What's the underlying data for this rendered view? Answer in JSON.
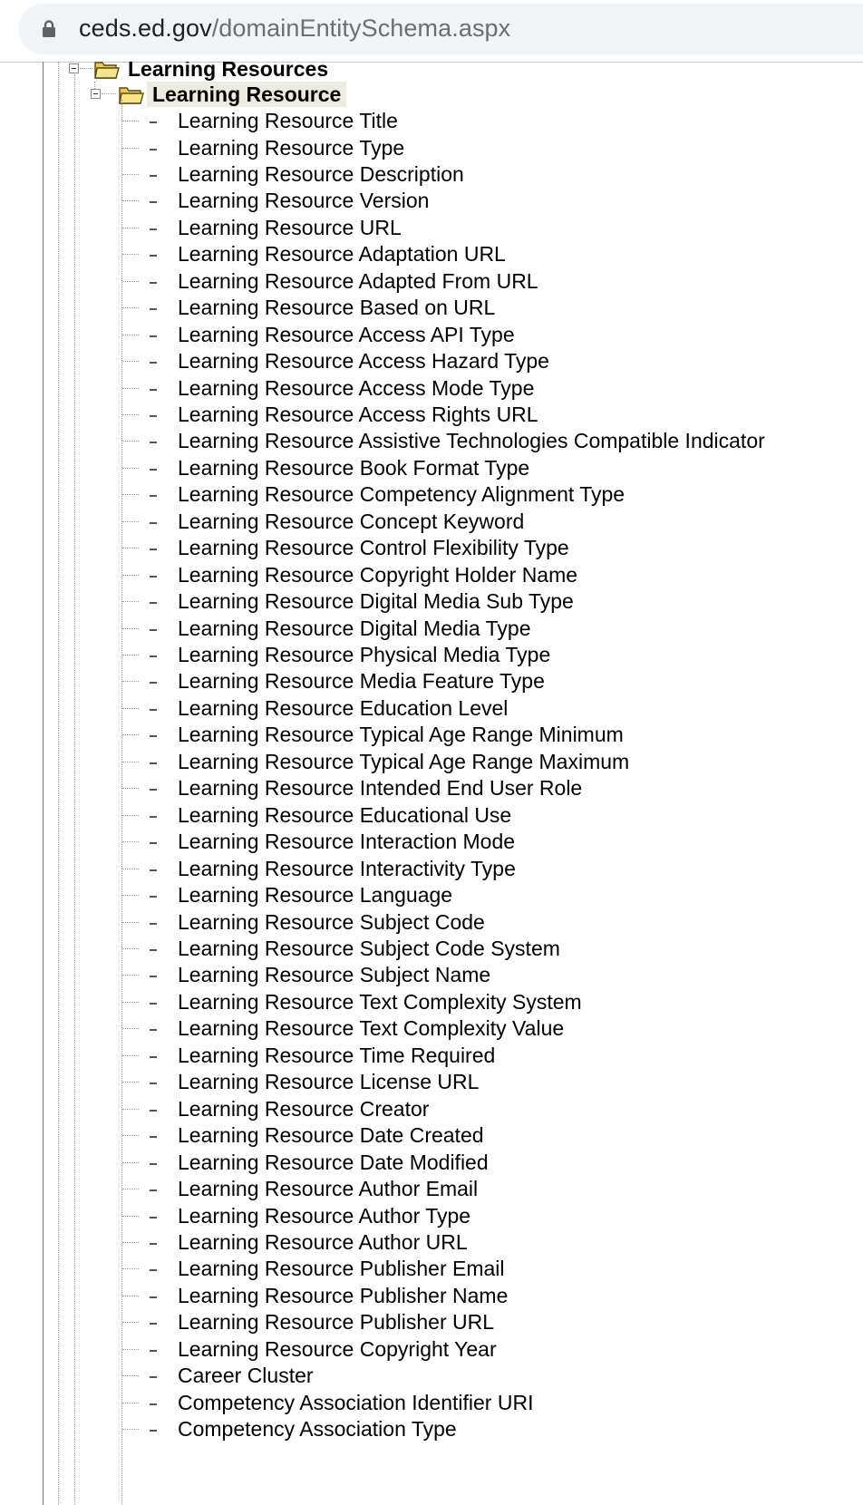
{
  "browser": {
    "url_host": "ceds.ed.gov",
    "url_path": "/domainEntitySchema.aspx"
  },
  "tree": {
    "parent": {
      "label": "Learning Resources"
    },
    "child": {
      "label": "Learning Resource"
    },
    "items": [
      "Learning Resource Title",
      "Learning Resource Type",
      "Learning Resource Description",
      "Learning Resource Version",
      "Learning Resource URL",
      "Learning Resource Adaptation URL",
      "Learning Resource Adapted From URL",
      "Learning Resource Based on URL",
      "Learning Resource Access API Type",
      "Learning Resource Access Hazard Type",
      "Learning Resource Access Mode Type",
      "Learning Resource Access Rights URL",
      "Learning Resource Assistive Technologies Compatible Indicator",
      "Learning Resource Book Format Type",
      "Learning Resource Competency Alignment Type",
      "Learning Resource Concept Keyword",
      "Learning Resource Control Flexibility Type",
      "Learning Resource Copyright Holder Name",
      "Learning Resource Digital Media Sub Type",
      "Learning Resource Digital Media Type",
      "Learning Resource Physical Media Type",
      "Learning Resource Media Feature Type",
      "Learning Resource Education Level",
      "Learning Resource Typical Age Range Minimum",
      "Learning Resource Typical Age Range Maximum",
      "Learning Resource Intended End User Role",
      "Learning Resource Educational Use",
      "Learning Resource Interaction Mode",
      "Learning Resource Interactivity Type",
      "Learning Resource Language",
      "Learning Resource Subject Code",
      "Learning Resource Subject Code System",
      "Learning Resource Subject Name",
      "Learning Resource Text Complexity System",
      "Learning Resource Text Complexity Value",
      "Learning Resource Time Required",
      "Learning Resource License URL",
      "Learning Resource Creator",
      "Learning Resource Date Created",
      "Learning Resource Date Modified",
      "Learning Resource Author Email",
      "Learning Resource Author Type",
      "Learning Resource Author URL",
      "Learning Resource Publisher Email",
      "Learning Resource Publisher Name",
      "Learning Resource Publisher URL",
      "Learning Resource Copyright Year",
      "Career Cluster",
      "Competency Association Identifier URI",
      "Competency Association Type"
    ]
  }
}
